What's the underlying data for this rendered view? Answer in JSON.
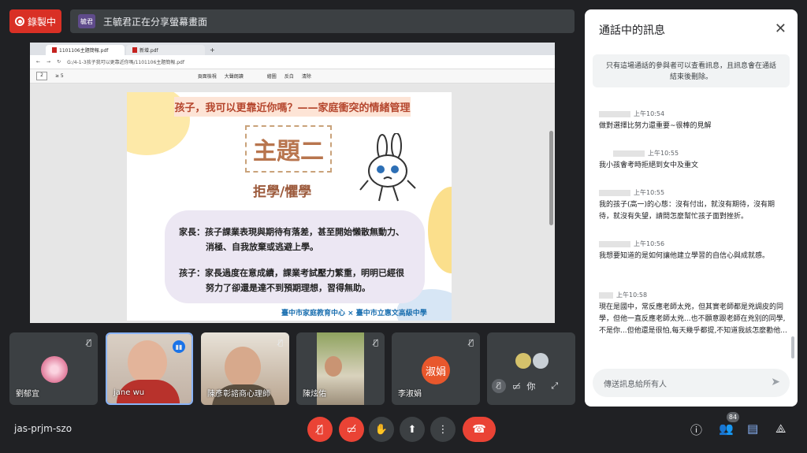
{
  "top": {
    "rec_label": "錄製中",
    "presenter_avatar": "毓君",
    "share_text": "王毓君正在分享螢幕畫面"
  },
  "browser": {
    "tabs": [
      "1101106主題簡報.pdf",
      "新增.pdf"
    ],
    "address": "G:/4-1-3孩子我可以更靠近你嗎/1101106主題簡報.pdf",
    "page_current": "2",
    "page_total": "≥ 5",
    "toolbar_items": [
      "頁面檢視",
      "大聲朗讀",
      "繪圖",
      "反白",
      "清除"
    ]
  },
  "slide": {
    "strip": "孩子，我可以更靠近你嗎？——家庭衝突的情緒管理",
    "topic": "主題二",
    "subtopic": "拒學/懼學",
    "parent_line1": "家長：孩子課業表現與期待有落差，甚至開始懶散無動力、",
    "parent_line2": "消極、自我放棄或逃避上學。",
    "child_line1": "孩子：家長過度在意成績，課業考試壓力繁重，明明已經很",
    "child_line2": "努力了卻還是達不到預期理想，習得無助。",
    "footer": "臺中市家庭教育中心 × 臺中市立惠文高級中學"
  },
  "chat": {
    "title": "通話中的訊息",
    "notice": "只有這場通話的參與者可以查看訊息，且訊息會在通話結束後刪除。",
    "messages": [
      {
        "time": "上午10:54",
        "text": "做對選擇比努力還重要~很棒的見解"
      },
      {
        "time": "上午10:55",
        "text": "我小孩會考時拒絕到女中及重文"
      },
      {
        "time": "上午10:55",
        "text": "我的孩子(高一)的心態：沒有付出，就沒有期待，沒有期待，就沒有失望，請問怎麼幫忙孩子面對挫折。"
      },
      {
        "time": "上午10:56",
        "text": "我想要知道的是如何讓他建立學習的自信心與成就感。"
      },
      {
        "time": "上午10:58",
        "text": "現在是國中，常反應老師太兇，但其實老師都是兇調皮的同學，但他一直反應老師太兇...也不願意跟老師在兇別的同學,不是你...但他還是很怕,每天幾乎都提,不知道我該怎麼勸他..."
      }
    ],
    "input_placeholder": "傳送訊息給所有人"
  },
  "participants": [
    {
      "name": "劉郁宜"
    },
    {
      "name": "jane wu"
    },
    {
      "name": "陳彥彰諮商心理師"
    },
    {
      "name": "陳炫佑"
    },
    {
      "name": "李淑娟",
      "initials": "淑娟"
    },
    {
      "name": "你"
    }
  ],
  "meeting_code": "jas-prjm-szo",
  "participant_count": "84",
  "colors": {
    "red": "#ea4335",
    "accent": "#8ab4f8"
  }
}
